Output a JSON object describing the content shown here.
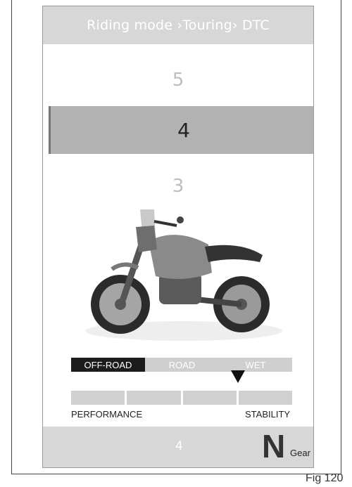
{
  "header": {
    "title": "Riding mode ›Touring› DTC"
  },
  "options": {
    "above": "5",
    "selected": "4",
    "below": "3"
  },
  "mode_tabs": [
    {
      "label": "OFF-ROAD",
      "active": true
    },
    {
      "label": "ROAD",
      "active": false
    },
    {
      "label": "WET",
      "active": false
    }
  ],
  "level_scale": {
    "left_label": "PERFORMANCE",
    "right_label": "STABILITY",
    "segments": 4,
    "marker_segment": 4
  },
  "footer": {
    "value": "4",
    "gear": "N",
    "gear_label": "Gear"
  },
  "caption": "Fig 120",
  "colors": {
    "selected_bg": "#b2b2b2",
    "active_tab": "#1c1c1c",
    "inactive": "#cfcfcf"
  }
}
